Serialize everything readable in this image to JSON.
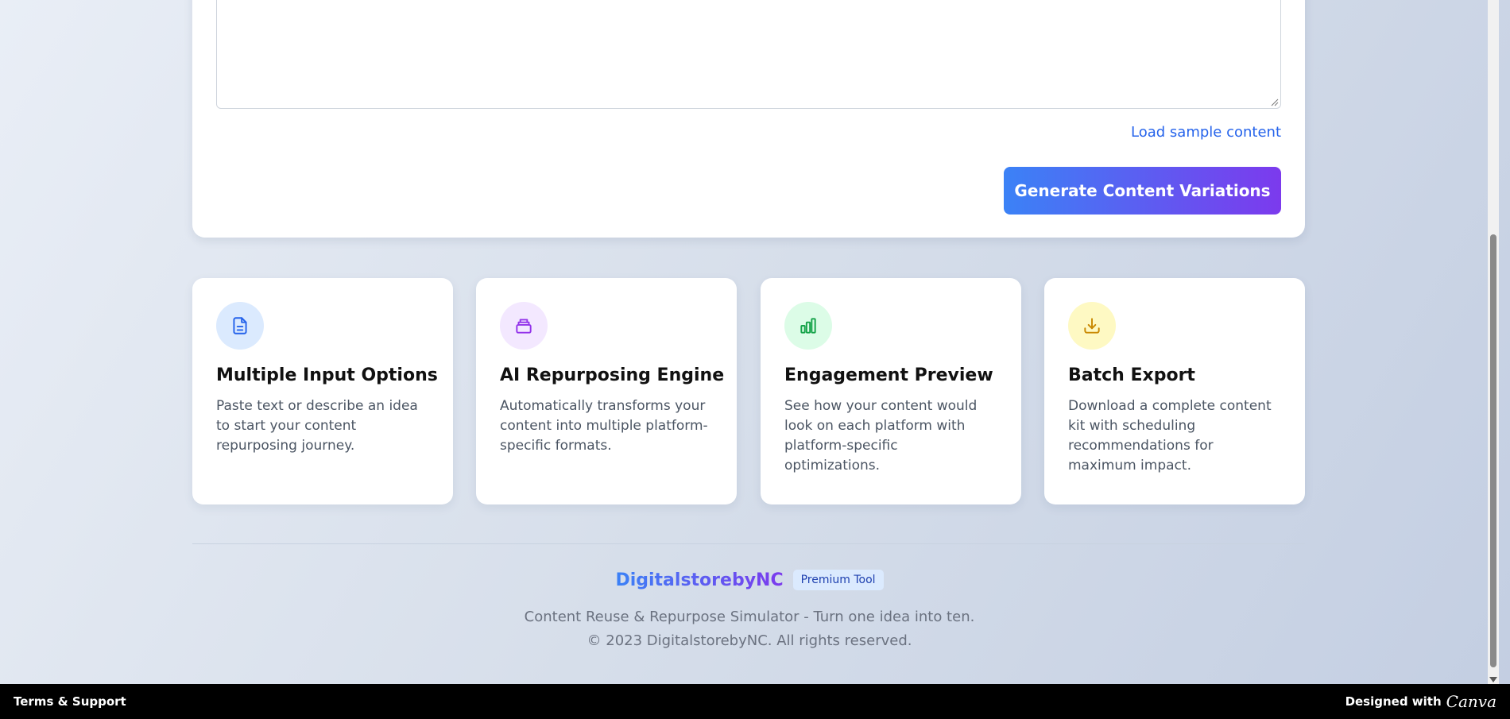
{
  "input_card": {
    "sample_link": "Load sample content",
    "generate_button": "Generate Content Variations"
  },
  "features": [
    {
      "icon": "document-icon",
      "icon_bg": "#dbeafe",
      "icon_color": "#2563eb",
      "title": "Multiple Input Options",
      "description": "Paste text or describe an idea to start your content repurposing journey."
    },
    {
      "icon": "layers-icon",
      "icon_bg": "#f3e8ff",
      "icon_color": "#9333ea",
      "title": "AI Repurposing Engine",
      "description": "Automatically transforms your content into multiple platform-specific formats."
    },
    {
      "icon": "bar-chart-icon",
      "icon_bg": "#dcfce7",
      "icon_color": "#16a34a",
      "title": "Engagement Preview",
      "description": "See how your content would look on each platform with platform-specific optimizations."
    },
    {
      "icon": "download-icon",
      "icon_bg": "#fef9c3",
      "icon_color": "#ca8a04",
      "title": "Batch Export",
      "description": "Download a complete content kit with scheduling recommendations for maximum impact."
    }
  ],
  "footer": {
    "brand": "DigitalstorebyNC",
    "badge": "Premium Tool",
    "tagline": "Content Reuse & Repurpose Simulator - Turn one idea into ten.",
    "copyright": "© 2023 DigitalstorebyNC. All rights reserved."
  },
  "bottom_bar": {
    "terms": "Terms & Support",
    "designed_with": "Designed with",
    "canva": "Canva"
  },
  "colors": {
    "accent_start": "#3b82f6",
    "accent_end": "#7c3aed",
    "link": "#2563eb"
  }
}
